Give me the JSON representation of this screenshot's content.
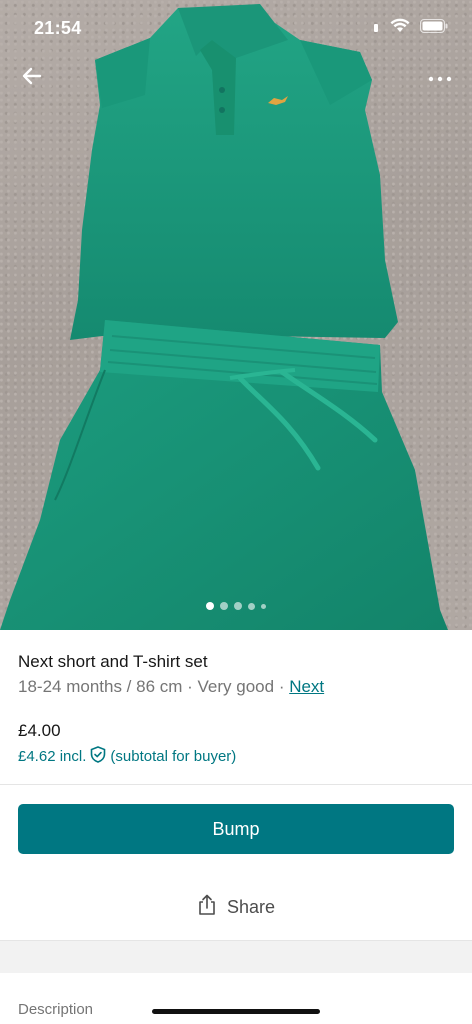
{
  "status_bar": {
    "time": "21:54"
  },
  "listing": {
    "title": "Next short and T-shirt set",
    "size": "18-24 months / 86 cm",
    "separator": " · ",
    "condition": "Very good",
    "brand": "Next",
    "price": "£4.00",
    "price_incl": "£4.62 incl.",
    "price_incl_note": "(subtotal for buyer)"
  },
  "photo_carousel": {
    "count": 5,
    "active_index": 0
  },
  "actions": {
    "bump_label": "Bump",
    "share_label": "Share"
  },
  "section": {
    "description_label": "Description"
  },
  "icons": {
    "back": "arrow-left-icon",
    "more": "more-horizontal-icon",
    "protection": "shield-check-icon",
    "share": "share-upload-icon"
  },
  "colors": {
    "accent": "#007782",
    "garment": "#1a9a7c"
  }
}
